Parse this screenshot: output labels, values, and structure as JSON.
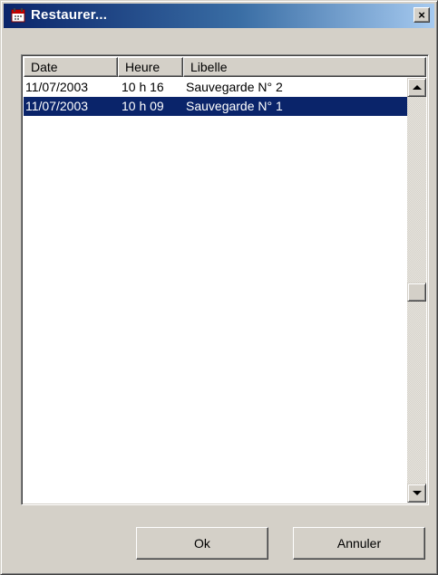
{
  "window": {
    "title": "Restaurer...",
    "close_label": "×",
    "titlebar_color": "#0a246a"
  },
  "table": {
    "columns": [
      {
        "label": "Date"
      },
      {
        "label": "Heure"
      },
      {
        "label": "Libelle"
      }
    ],
    "rows": [
      {
        "date": "11/07/2003",
        "time": "10 h 16",
        "label": "Sauvegarde N° 2",
        "selected": false
      },
      {
        "date": "11/07/2003",
        "time": "10 h 09",
        "label": "Sauvegarde N° 1",
        "selected": true
      }
    ],
    "selection_color": "#0a246a"
  },
  "buttons": {
    "ok_label": "Ok",
    "cancel_label": "Annuler"
  },
  "icons": {
    "app_icon": "calendar-icon",
    "close_icon": "close-icon",
    "scroll_up": "arrow-up-icon",
    "scroll_down": "arrow-down-icon"
  }
}
